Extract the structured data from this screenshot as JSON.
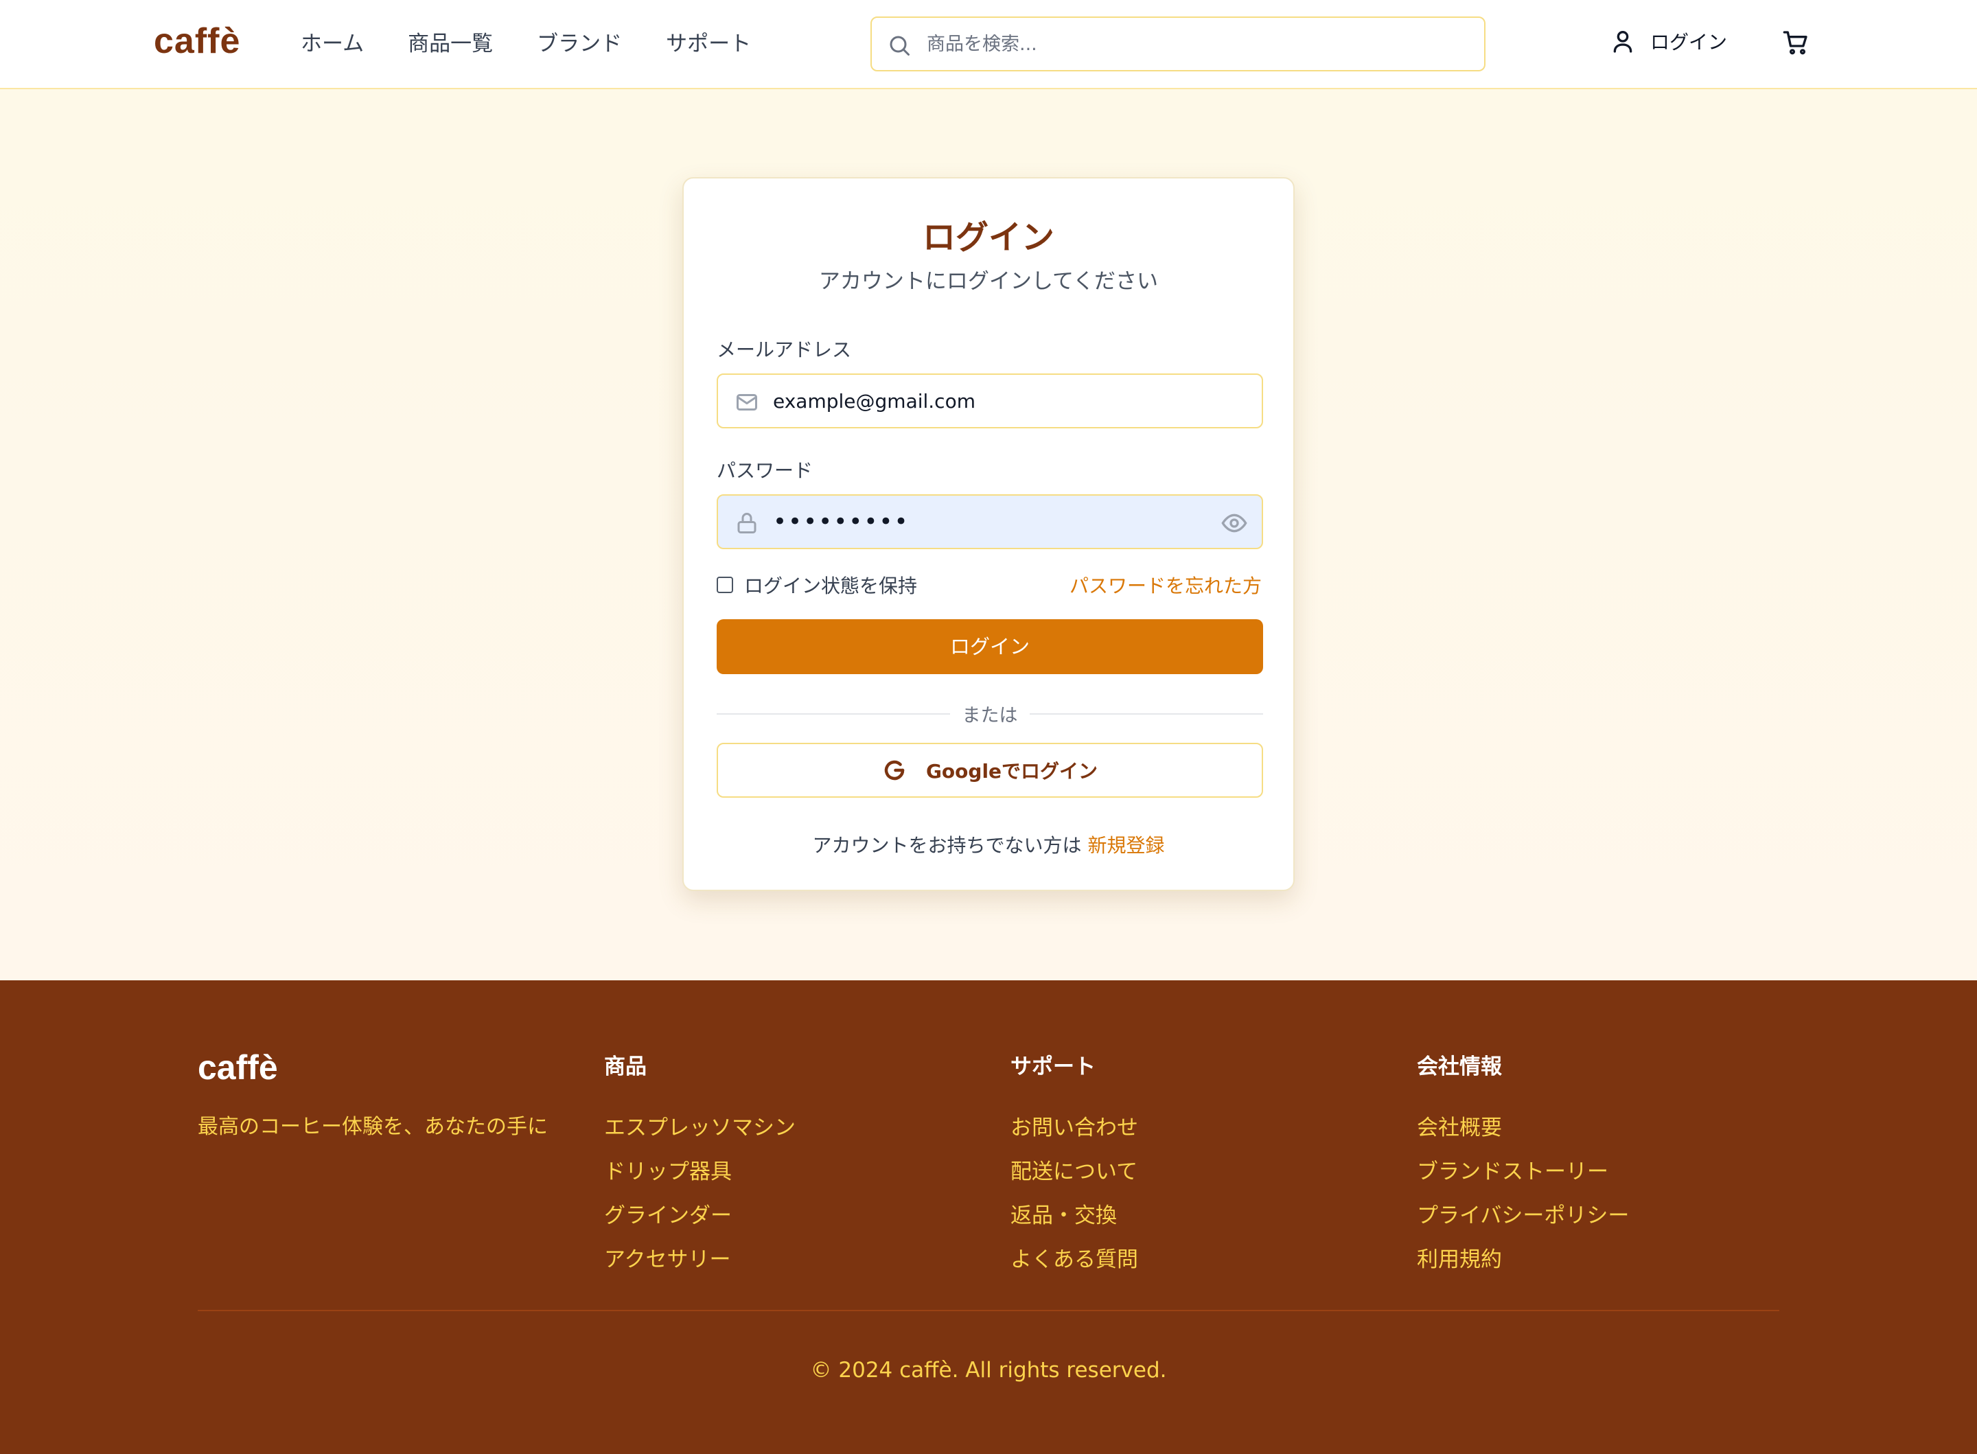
{
  "header": {
    "logo": "caffè",
    "nav": [
      "ホーム",
      "商品一覧",
      "ブランド",
      "サポート"
    ],
    "search_placeholder": "商品を検索...",
    "login_label": "ログイン"
  },
  "login_card": {
    "title": "ログイン",
    "subtitle": "アカウントにログインしてください",
    "email_label": "メールアドレス",
    "email_value": "example@gmail.com",
    "password_label": "パスワード",
    "password_value": "•••••••••",
    "remember_label": "ログイン状態を保持",
    "remember_checked": false,
    "forgot_label": "パスワードを忘れた方",
    "submit_label": "ログイン",
    "divider_text": "または",
    "google_label": "Googleでログイン",
    "signup_prompt": "アカウントをお持ちでない方は",
    "signup_link": "新規登録"
  },
  "footer": {
    "logo": "caffè",
    "tagline": "最高のコーヒー体験を、あなたの手に",
    "columns": [
      {
        "title": "商品",
        "links": [
          "エスプレッソマシン",
          "ドリップ器具",
          "グラインダー",
          "アクセサリー"
        ]
      },
      {
        "title": "サポート",
        "links": [
          "お問い合わせ",
          "配送について",
          "返品・交換",
          "よくある質問"
        ]
      },
      {
        "title": "会社情報",
        "links": [
          "会社概要",
          "ブランドストーリー",
          "プライバシーポリシー",
          "利用規約"
        ]
      }
    ],
    "copyright": "© 2024 caffè. All rights reserved."
  },
  "colors": {
    "brand_brown": "#7c3410",
    "accent_orange": "#d97706",
    "footer_link": "#fcd34d",
    "page_bg": "#fef9e8"
  },
  "icons": [
    "search-icon",
    "user-icon",
    "cart-icon",
    "mail-icon",
    "lock-icon",
    "eye-icon",
    "google-icon"
  ]
}
